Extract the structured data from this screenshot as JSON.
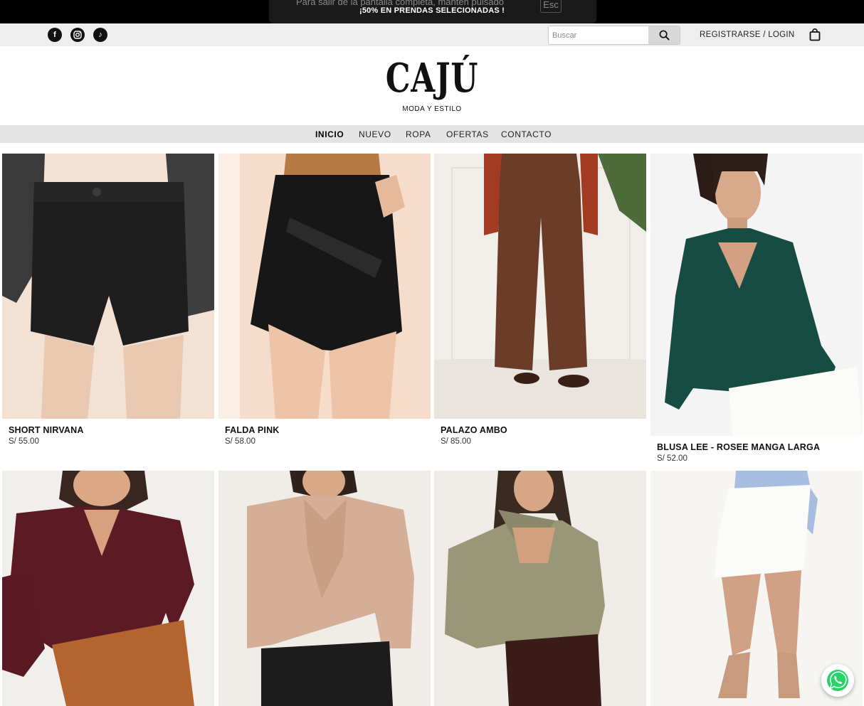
{
  "fullscreen_hint": {
    "text": "Para salir de la pantalla completa, mantén pulsado",
    "key": "Esc"
  },
  "announcement": "¡50% EN PRENDAS SELECIONADAS !",
  "social": {
    "facebook": "f",
    "instagram": "◎",
    "tiktok": "♪"
  },
  "search": {
    "placeholder": "Buscar",
    "value": ""
  },
  "account": {
    "login_label": "REGISTRARSE / LOGIN"
  },
  "brand": {
    "name": "CAJÚ",
    "tagline": "MODA Y ESTILO"
  },
  "nav": [
    {
      "label": "INICIO",
      "active": true
    },
    {
      "label": "NUEVO"
    },
    {
      "label": "ROPA"
    },
    {
      "label": "OFERTAS"
    },
    {
      "label": "CONTACTO"
    }
  ],
  "products": [
    {
      "name": "SHORT NIRVANA",
      "price": "S/ 55.00",
      "color": "#1c1c1c"
    },
    {
      "name": "FALDA PINK",
      "price": "S/ 58.00",
      "color": "#181818"
    },
    {
      "name": "PALAZO AMBO",
      "price": "S/ 85.00",
      "color": "#6b3f2b"
    },
    {
      "name": "BLUSA LEE - ROSEE MANGA LARGA",
      "price": "S/ 52.00",
      "color": "#164a40"
    },
    {
      "name": "",
      "price": "",
      "color": "#5a1a22"
    },
    {
      "name": "",
      "price": "",
      "color": "#d2b09a"
    },
    {
      "name": "",
      "price": "",
      "color": "#9c9a7e"
    },
    {
      "name": "",
      "price": "",
      "color": "#f3f2ee"
    }
  ],
  "whatsapp_icon": "whatsapp-icon"
}
